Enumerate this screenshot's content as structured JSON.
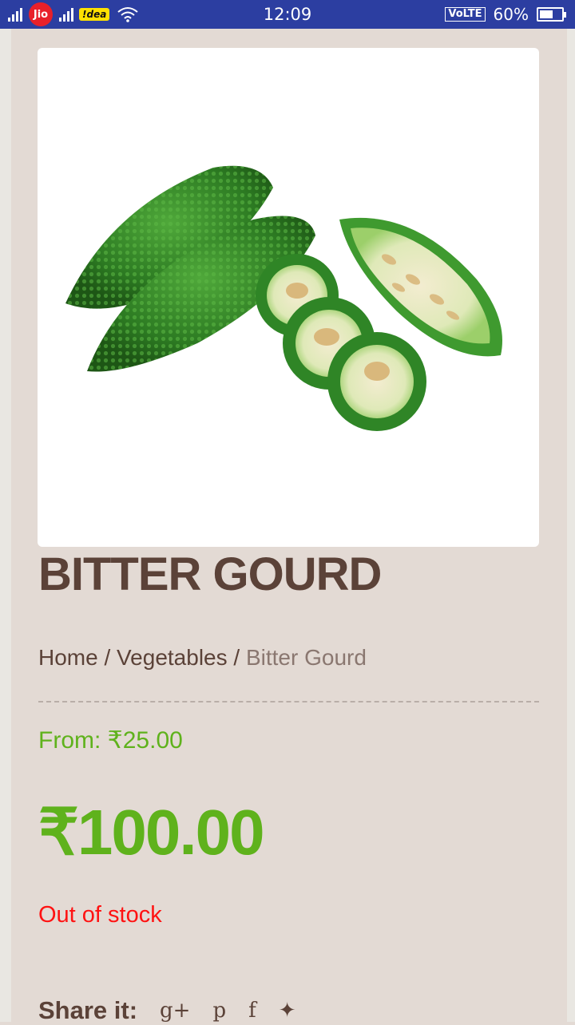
{
  "status_bar": {
    "carrier1": "Jio",
    "carrier2": "!dea",
    "time": "12:09",
    "volte": "VoLTE",
    "battery_percent": "60%",
    "battery_level": 0.6
  },
  "product": {
    "title": "BITTER GOURD",
    "image_alt": "Bitter gourd with slices"
  },
  "breadcrumb": {
    "items": [
      "Home",
      "Vegetables",
      "Bitter Gourd"
    ],
    "separator": "/"
  },
  "pricing": {
    "from_label": "From: ₹25.00",
    "price": "₹100.00"
  },
  "stock_status": "Out of stock",
  "share": {
    "label": "Share it:",
    "icons": [
      {
        "name": "google-plus-icon",
        "glyph": "g+"
      },
      {
        "name": "pinterest-icon",
        "glyph": "p"
      },
      {
        "name": "facebook-icon",
        "glyph": "f"
      },
      {
        "name": "twitter-icon",
        "glyph": "✦"
      }
    ]
  },
  "colors": {
    "background": "#e3dad4",
    "title": "#5b4238",
    "price_green": "#5fb21c",
    "stock_red": "#ff1212",
    "statusbar": "#2c3ea1"
  }
}
